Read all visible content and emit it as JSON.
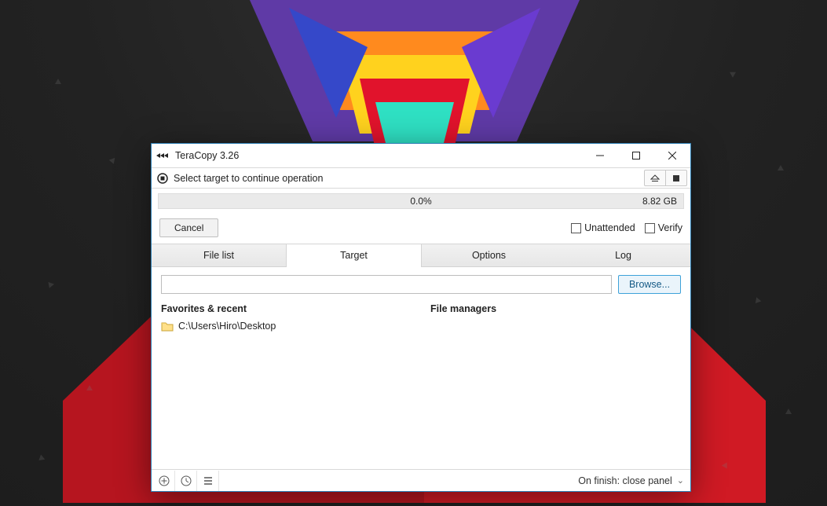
{
  "window": {
    "title": "TeraCopy 3.26"
  },
  "status": {
    "message": "Select target to continue operation"
  },
  "progress": {
    "percent_text": "0.0%",
    "total_size": "8.82 GB"
  },
  "actions": {
    "cancel_label": "Cancel"
  },
  "checkboxes": {
    "unattended_label": "Unattended",
    "verify_label": "Verify"
  },
  "tabs": {
    "file_list": "File list",
    "target": "Target",
    "options": "Options",
    "log": "Log",
    "active": "target"
  },
  "target_tab": {
    "path_value": "",
    "browse_label": "Browse...",
    "favorites_heading": "Favorites & recent",
    "favorites": [
      {
        "path": "C:\\Users\\Hiro\\Desktop"
      }
    ],
    "file_managers_heading": "File managers"
  },
  "bottom": {
    "on_finish_label": "On finish: close panel"
  }
}
